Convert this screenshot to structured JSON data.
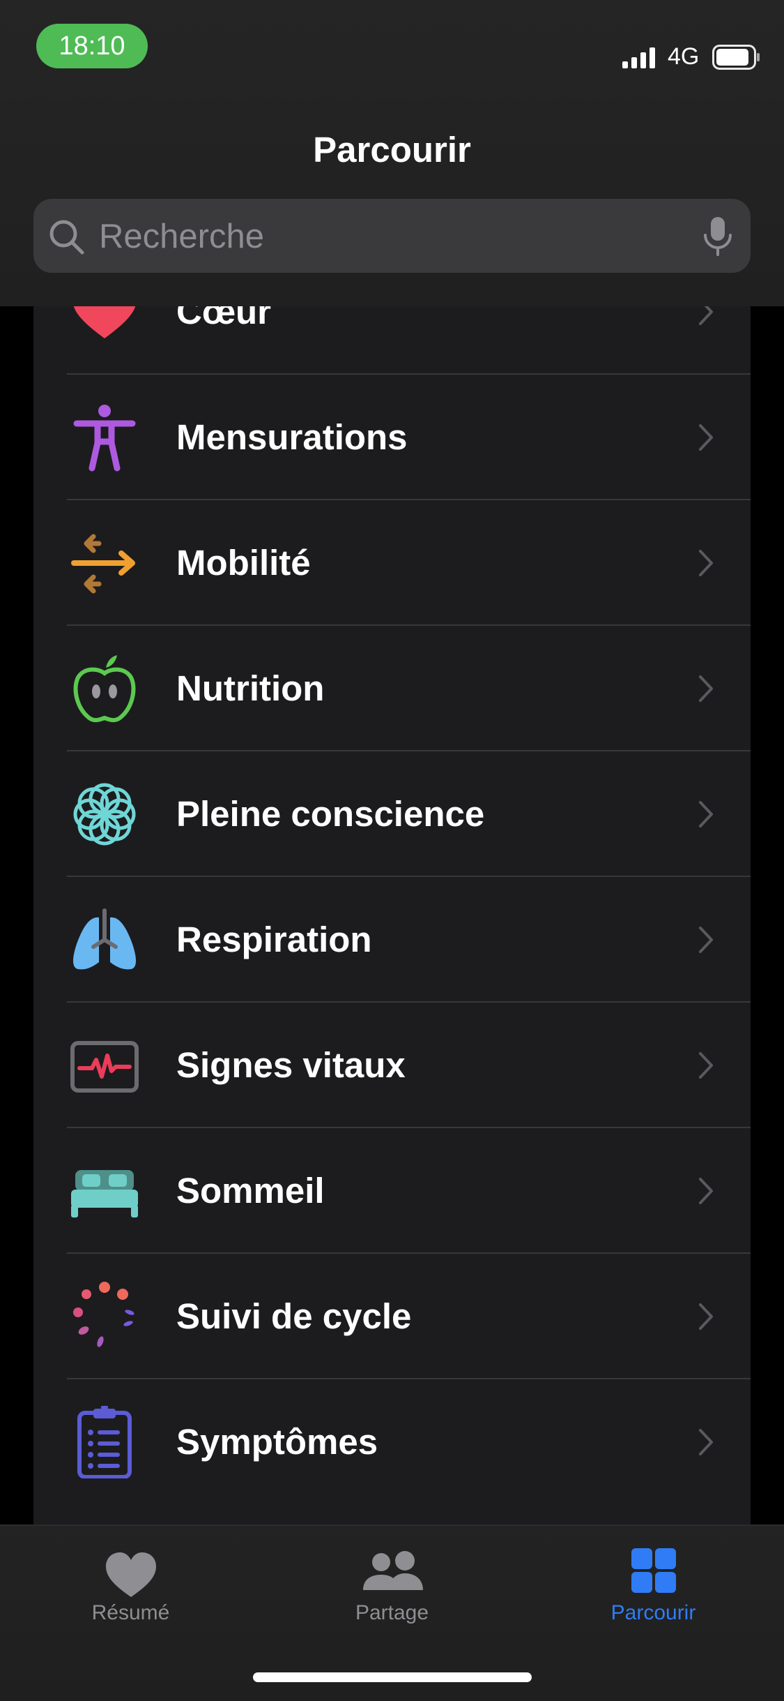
{
  "status": {
    "time": "18:10",
    "network": "4G"
  },
  "nav": {
    "title": "Parcourir"
  },
  "search": {
    "placeholder": "Recherche"
  },
  "categories": [
    {
      "label": "Cœur",
      "icon": "heart-icon",
      "color": "#f0475c"
    },
    {
      "label": "Mensurations",
      "icon": "figure-icon",
      "color": "#ad5ae0"
    },
    {
      "label": "Mobilité",
      "icon": "arrows-icon",
      "color": "#f0a030"
    },
    {
      "label": "Nutrition",
      "icon": "apple-icon",
      "color": "#5cc950"
    },
    {
      "label": "Pleine conscience",
      "icon": "flower-icon",
      "color": "#6fd6d6"
    },
    {
      "label": "Respiration",
      "icon": "lungs-icon",
      "color": "#6ab8f2"
    },
    {
      "label": "Signes vitaux",
      "icon": "vitals-icon",
      "color": "#ea3d5b"
    },
    {
      "label": "Sommeil",
      "icon": "bed-icon",
      "color": "#6fcfc8"
    },
    {
      "label": "Suivi de cycle",
      "icon": "cycle-icon",
      "color": "#ee6a5c"
    },
    {
      "label": "Symptômes",
      "icon": "clipboard-icon",
      "color": "#5b5cd6"
    }
  ],
  "tabs": [
    {
      "label": "Résumé",
      "icon": "heart-icon",
      "active": false
    },
    {
      "label": "Partage",
      "icon": "people-icon",
      "active": false
    },
    {
      "label": "Parcourir",
      "icon": "grid-icon",
      "active": true
    }
  ],
  "colors": {
    "accent": "#2f7cf6",
    "inactive": "#8e8e93",
    "list_bg": "#1c1c1e"
  }
}
